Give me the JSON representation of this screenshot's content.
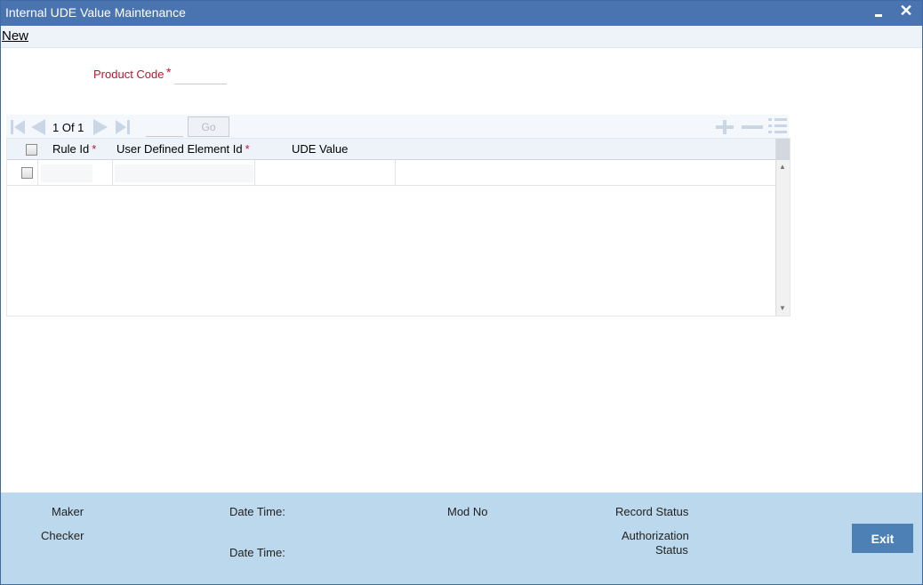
{
  "window": {
    "title": "Internal UDE Value Maintenance"
  },
  "menu": {
    "new_label": "New"
  },
  "form": {
    "product_code_label": "Product Code",
    "required_marker": "*",
    "product_code_value": ""
  },
  "grid": {
    "pagination": {
      "page_text": "1 Of 1",
      "go_label": "Go",
      "page_input_value": ""
    },
    "columns": [
      {
        "label": "Rule Id",
        "required": "*"
      },
      {
        "label": "User Defined Element Id",
        "required": "*"
      },
      {
        "label": "UDE Value",
        "required": ""
      }
    ],
    "rows": [
      {
        "rule_id": "",
        "element_id": "",
        "ude_value": ""
      }
    ]
  },
  "footer": {
    "maker_label": "Maker",
    "checker_label": "Checker",
    "date_time_label_1": "Date Time:",
    "date_time_label_2": "Date Time:",
    "mod_no_label": "Mod No",
    "record_status_label": "Record Status",
    "authorization_label": "Authorization",
    "status_label": "Status",
    "exit_label": "Exit"
  },
  "colors": {
    "title_bar": "#4a74b0",
    "footer": "#bcd8ec",
    "required": "#c0142d",
    "exit_button": "#4d80b4"
  },
  "icons": [
    "minimize-icon",
    "close-icon",
    "first-page-icon",
    "prev-page-icon",
    "next-page-icon",
    "last-page-icon",
    "add-row-icon",
    "delete-row-icon",
    "multi-entry-icon"
  ]
}
